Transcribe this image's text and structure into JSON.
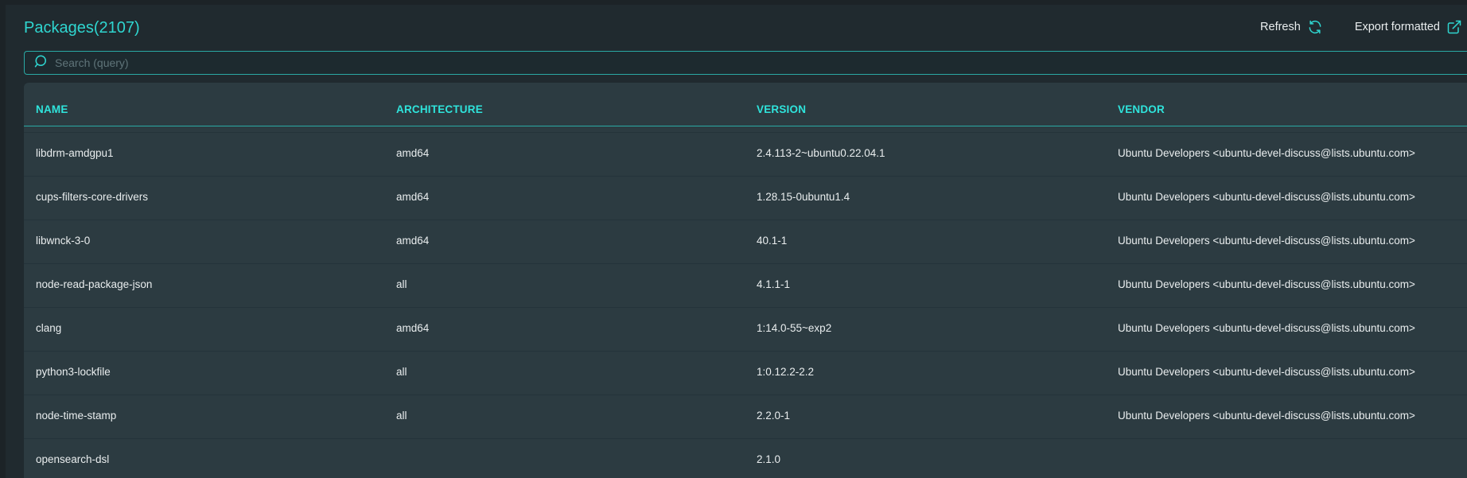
{
  "header": {
    "title": "Packages(2107)",
    "refresh_label": "Refresh",
    "export_label": "Export formatted"
  },
  "search": {
    "placeholder": "Search (query)",
    "value": ""
  },
  "table": {
    "columns": [
      "NAME",
      "ARCHITECTURE",
      "VERSION",
      "VENDOR"
    ],
    "rows": [
      {
        "name": "libdrm-amdgpu1",
        "architecture": "amd64",
        "version": "2.4.113-2~ubuntu0.22.04.1",
        "vendor": "Ubuntu Developers <ubuntu-devel-discuss@lists.ubuntu.com>"
      },
      {
        "name": "cups-filters-core-drivers",
        "architecture": "amd64",
        "version": "1.28.15-0ubuntu1.4",
        "vendor": "Ubuntu Developers <ubuntu-devel-discuss@lists.ubuntu.com>"
      },
      {
        "name": "libwnck-3-0",
        "architecture": "amd64",
        "version": "40.1-1",
        "vendor": "Ubuntu Developers <ubuntu-devel-discuss@lists.ubuntu.com>"
      },
      {
        "name": "node-read-package-json",
        "architecture": "all",
        "version": "4.1.1-1",
        "vendor": "Ubuntu Developers <ubuntu-devel-discuss@lists.ubuntu.com>"
      },
      {
        "name": "clang",
        "architecture": "amd64",
        "version": "1:14.0-55~exp2",
        "vendor": "Ubuntu Developers <ubuntu-devel-discuss@lists.ubuntu.com>"
      },
      {
        "name": "python3-lockfile",
        "architecture": "all",
        "version": "1:0.12.2-2.2",
        "vendor": "Ubuntu Developers <ubuntu-devel-discuss@lists.ubuntu.com>"
      },
      {
        "name": "node-time-stamp",
        "architecture": "all",
        "version": "2.2.0-1",
        "vendor": "Ubuntu Developers <ubuntu-devel-discuss@lists.ubuntu.com>"
      },
      {
        "name": "opensearch-dsl",
        "architecture": "",
        "version": "2.1.0",
        "vendor": ""
      }
    ]
  },
  "icons": {
    "refresh": "refresh-icon",
    "export": "external-link-icon",
    "search": "search-icon"
  },
  "colors": {
    "accent": "#2fd6d0",
    "header_text": "#2fe4dc",
    "background": "#1c2327",
    "table_bg": "#2c3b41"
  }
}
